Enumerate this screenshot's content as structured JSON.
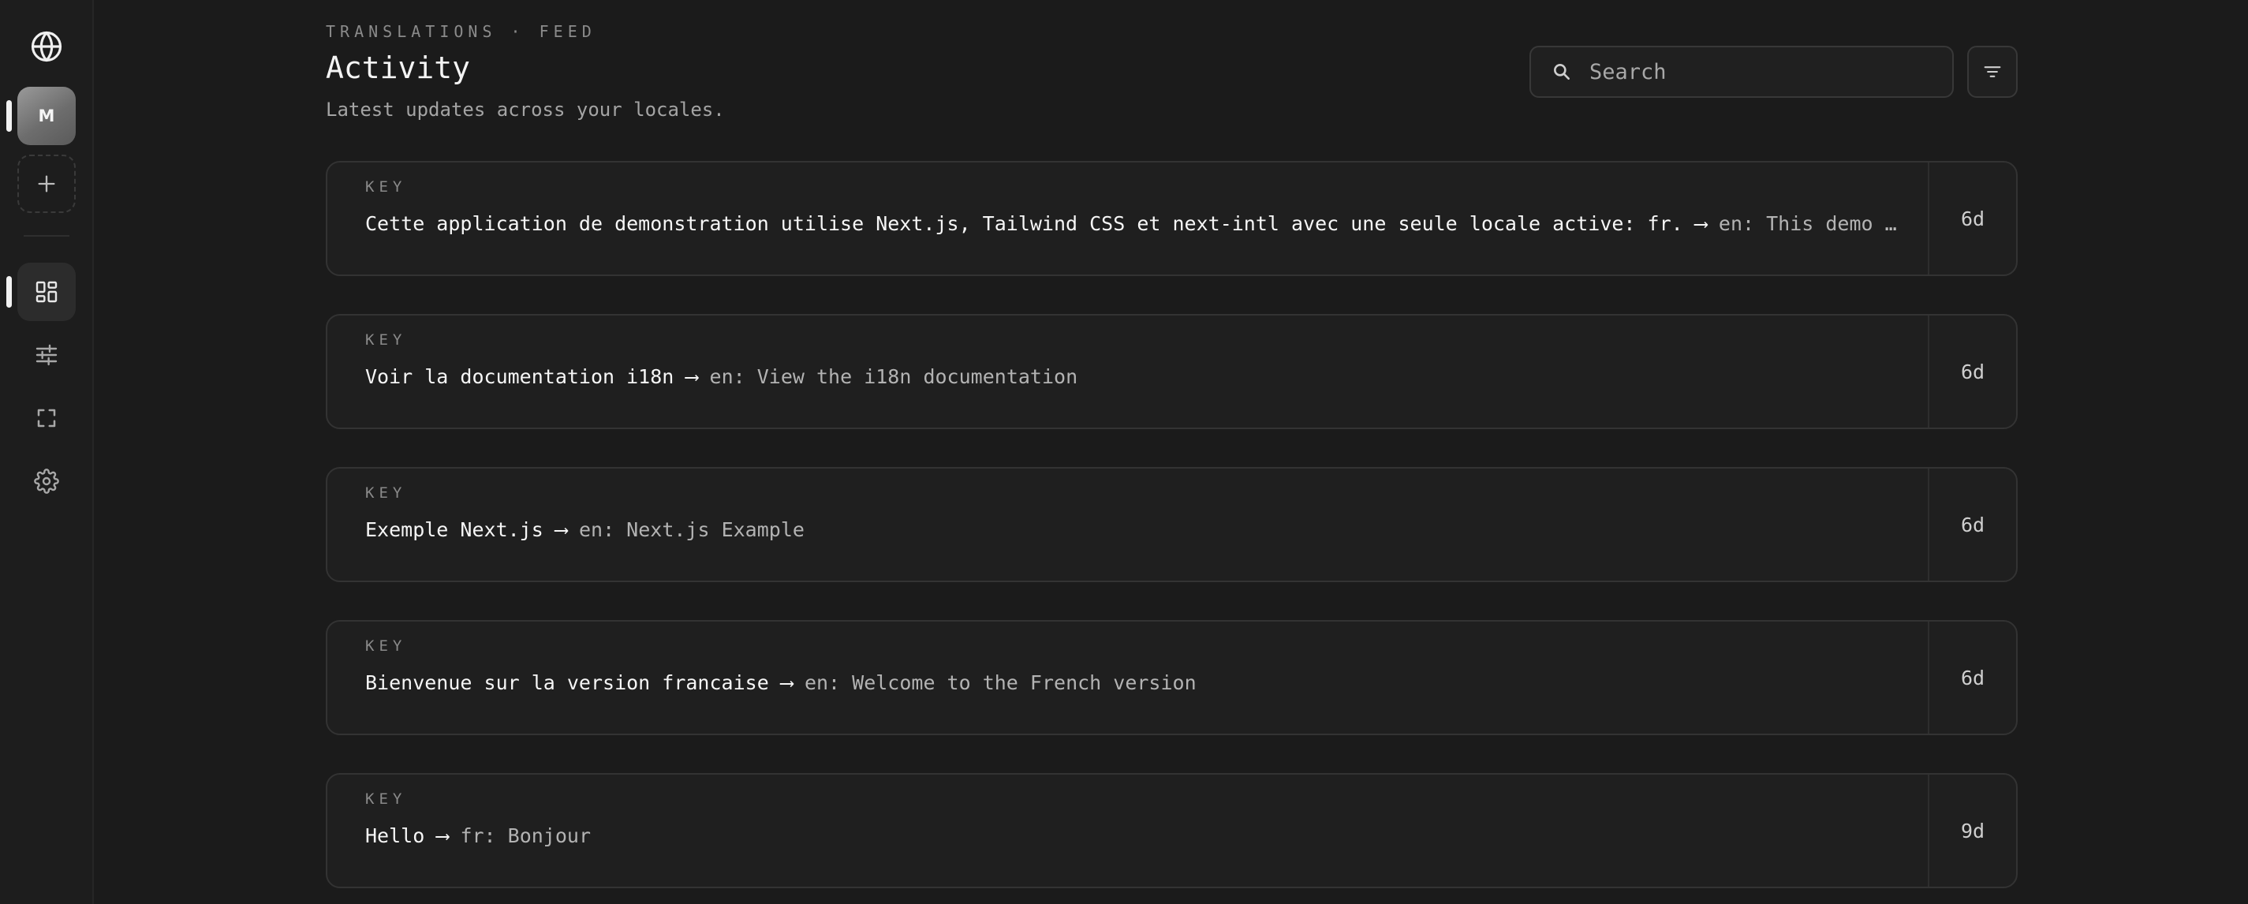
{
  "sidebar": {
    "logo_icon": "globe-icon",
    "workspace_initial": "M",
    "add_icon": "plus-icon",
    "nav": [
      {
        "id": "dashboard",
        "icon": "dashboard-icon",
        "active": true
      },
      {
        "id": "filters",
        "icon": "sliders-icon",
        "active": false
      },
      {
        "id": "fullscreen",
        "icon": "fullscreen-icon",
        "active": false
      },
      {
        "id": "settings",
        "icon": "gear-icon",
        "active": false
      }
    ]
  },
  "header": {
    "eyebrow": "TRANSLATIONS · FEED",
    "title": "Activity",
    "subtitle": "Latest updates across your locales."
  },
  "search": {
    "placeholder": "Search",
    "value": ""
  },
  "filter": {
    "icon": "filter-icon"
  },
  "feed": [
    {
      "label": "KEY",
      "source": "Cette application de demonstration utilise Next.js, Tailwind CSS et next-intl avec une seule locale active: fr.",
      "arrow": "⟶",
      "target": "en: This demo appli…",
      "age": "6d"
    },
    {
      "label": "KEY",
      "source": "Voir la documentation i18n",
      "arrow": "⟶",
      "target": "en: View the i18n documentation",
      "age": "6d"
    },
    {
      "label": "KEY",
      "source": "Exemple Next.js",
      "arrow": "⟶",
      "target": "en: Next.js Example",
      "age": "6d"
    },
    {
      "label": "KEY",
      "source": "Bienvenue sur la version francaise",
      "arrow": "⟶",
      "target": "en: Welcome to the French version",
      "age": "6d"
    },
    {
      "label": "KEY",
      "source": "Hello",
      "arrow": "⟶",
      "target": "fr: Bonjour",
      "age": "9d"
    }
  ]
}
